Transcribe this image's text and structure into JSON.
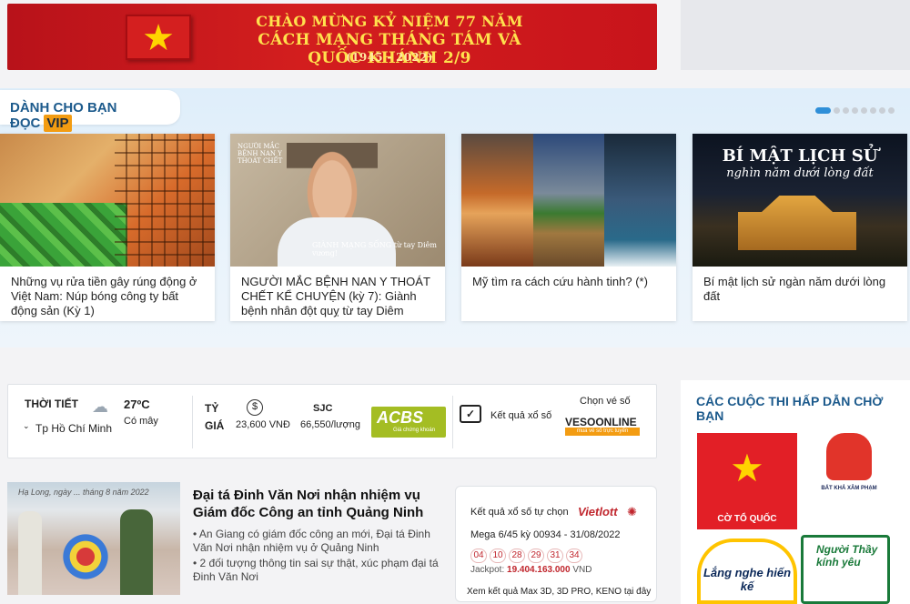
{
  "banner": {
    "line1": "CHÀO MỪNG KỶ NIỆM 77 NĂM",
    "line2": "CÁCH MẠNG THÁNG TÁM VÀ QUỐC KHÁNH 2/9",
    "line3": "(1945 - 2022)"
  },
  "vip": {
    "heading": "DÀNH CHO BẠN ĐỌC",
    "badge": "VIP",
    "cards": [
      {
        "title": "Những vụ rửa tiền gây rúng động ở Việt Nam: Núp bóng công ty bất động sản (Kỳ 1)"
      },
      {
        "title": "NGƯỜI MẮC BỆNH NAN Y THOÁT CHẾT KỂ CHUYỆN (kỳ 7): Giành bệnh nhân đột quỵ từ tay Diêm vương!",
        "img_label": "NGƯỜI MẮC BỆNH NAN Y THOÁT CHẾT",
        "img_caption": "GIÀNH MẠNG SỐNG từ tay Diêm vương!"
      },
      {
        "title": "Mỹ tìm ra cách cứu hành tinh? (*)"
      },
      {
        "title": "Bí mật lịch sử ngàn năm dưới lòng đất",
        "img_title": "BÍ MẬT LỊCH SỬ",
        "img_subtitle": "nghìn năm dưới lòng đất"
      }
    ]
  },
  "widget": {
    "weather_label": "THỜI TIẾT",
    "city": "Tp Hồ Chí Minh",
    "temp": "27ºC",
    "condition": "Có mây",
    "rate_label_1": "TỶ",
    "rate_label_2": "GIÁ",
    "usd_value": "23,600 VNĐ",
    "sjc_label": "SJC",
    "sjc_value": "66,550/lượng",
    "acbs_logo": "ACBS",
    "acbs_sub": "Giá chứng khoán",
    "lottery_label": "Kết quả xổ số",
    "ticket_label": "Chọn vé số",
    "veso_logo": "VESOONLINE",
    "veso_sub": "mua vé số trực tuyến"
  },
  "contest": {
    "heading": "CÁC CUỘC THI HẤP DẪN CHỜ BẠN",
    "flag_text": "CỜ TỔ QUỐC",
    "fist_text": "BẤT KHẢ XÂM PHẠM",
    "bulb_text": "Lắng nghe hiến kế",
    "teacher_text": "Người Thầy kính yêu"
  },
  "news": {
    "photo_caption": "Hạ Long, ngày ... tháng 8 năm 2022",
    "title": "Đại tá Đinh Văn Nơi nhận nhiệm vụ Giám đốc Công an tỉnh Quảng Ninh",
    "bullet1": "An Giang có giám đốc công an mới, Đại tá Đinh Văn Nơi nhận nhiệm vụ ở Quảng Ninh",
    "bullet2": "2 đối tượng thông tin sai sự thật, xúc phạm đại tá Đinh Văn Nơi"
  },
  "lotto": {
    "heading": "Kết quả xổ số tự chọn",
    "brand": "Vietlott",
    "draw": "Mega 6/45 kỳ 00934 - 31/08/2022",
    "balls": [
      "04",
      "10",
      "28",
      "29",
      "31",
      "34"
    ],
    "jackpot_label": "Jackpot:",
    "jackpot_value": "19.404.163.000",
    "jackpot_unit": "VND",
    "footer": "Xem kết quả Max 3D, 3D PRO, KENO tại đây"
  },
  "colors": {
    "accent": "#1c5a8c",
    "vip_badge": "#f39c12",
    "banner_red": "#c8141b",
    "ball_red": "#c0262d"
  }
}
